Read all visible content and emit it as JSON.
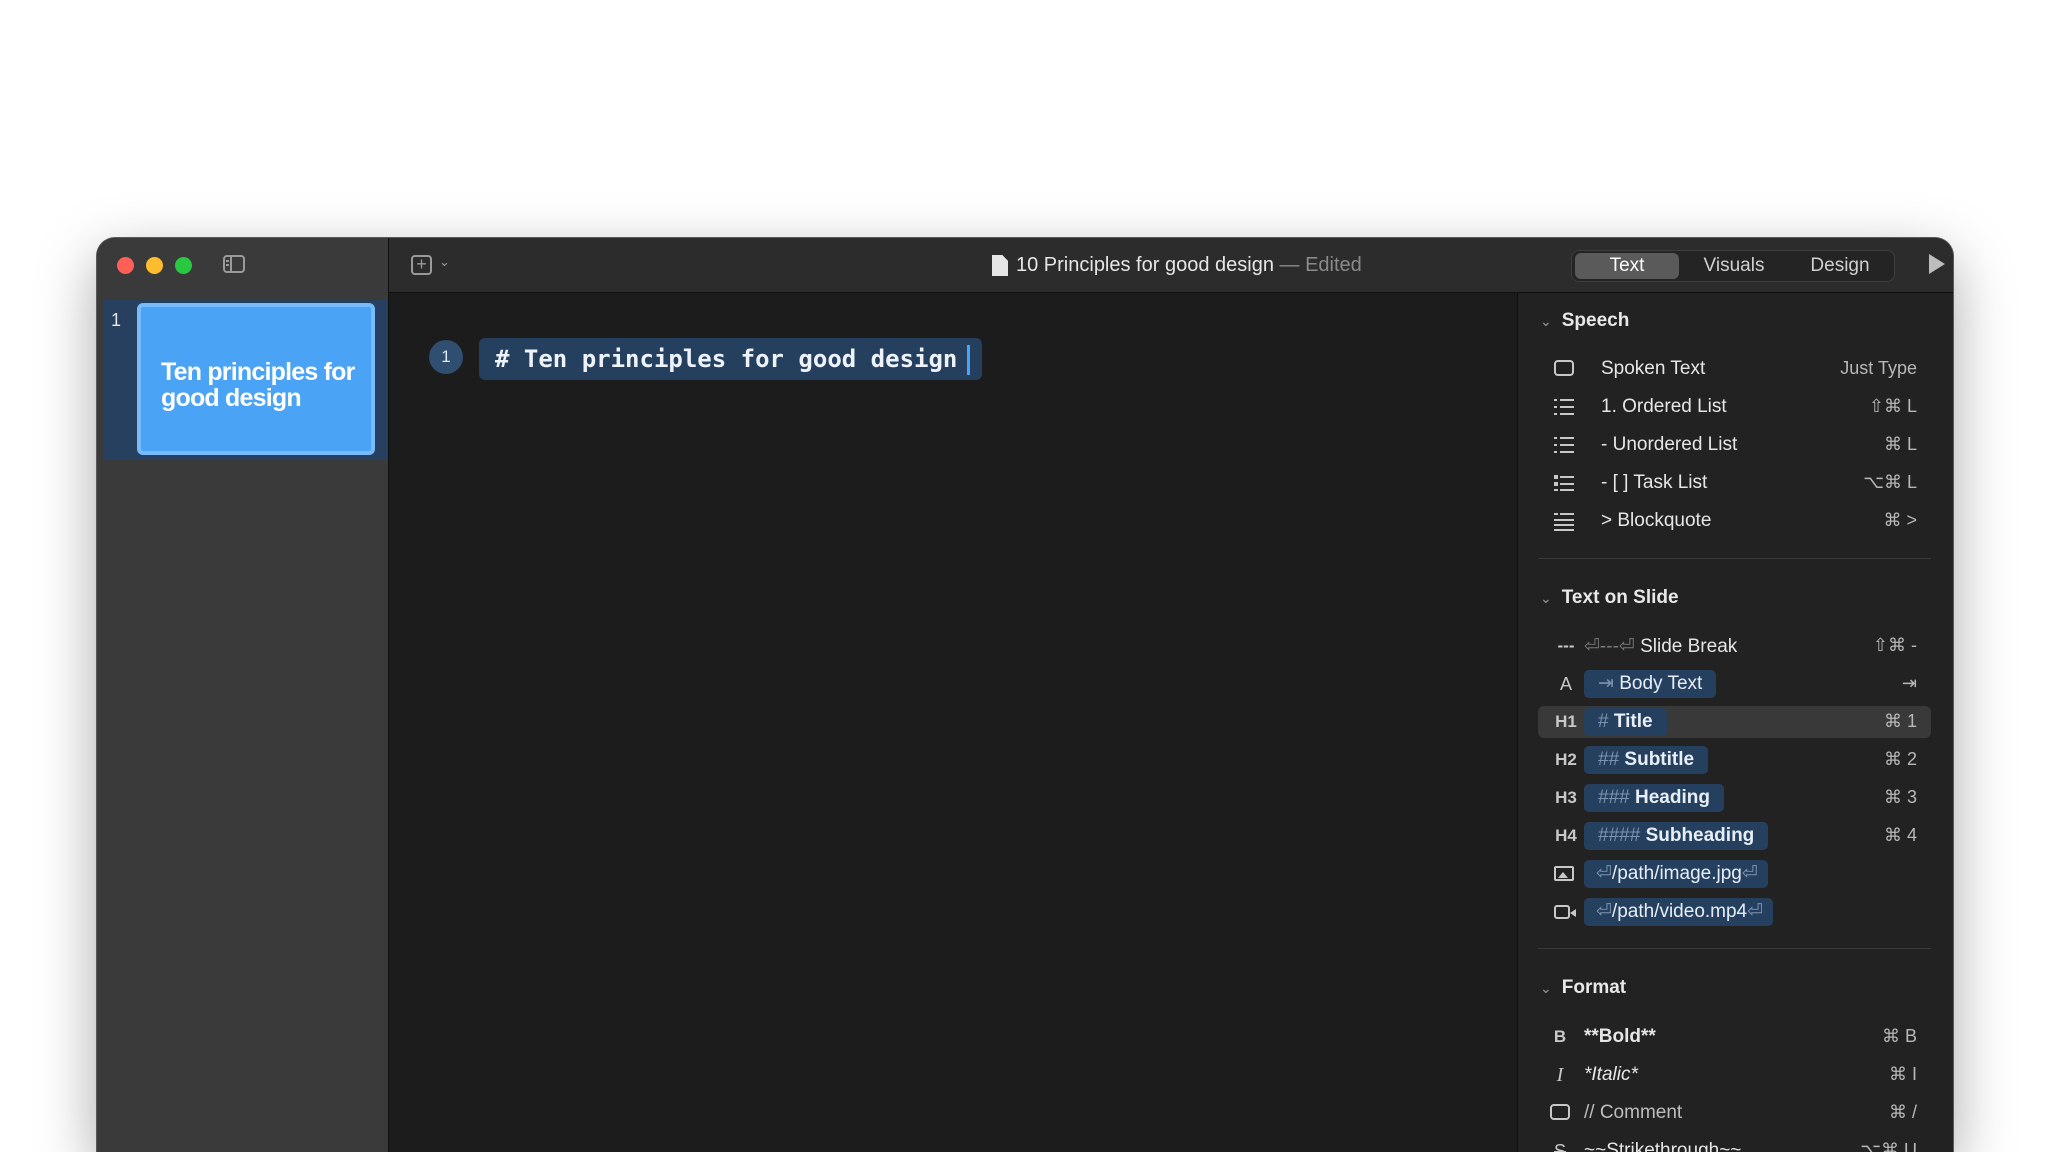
{
  "window": {
    "doc_title": "10 Principles for good design",
    "separator": "—",
    "edited": "Edited"
  },
  "toolbar": {
    "tabs": [
      {
        "label": "Text",
        "active": true
      },
      {
        "label": "Visuals",
        "active": false
      },
      {
        "label": "Design",
        "active": false
      }
    ]
  },
  "sidebar": {
    "slides": [
      {
        "number": "1",
        "title": "Ten principles for good design"
      }
    ]
  },
  "editor": {
    "lines": [
      {
        "number": "1",
        "text": "# Ten principles for good design"
      }
    ]
  },
  "panel": {
    "speech": {
      "title": "Speech",
      "items": [
        {
          "icon": "speech-bubble-icon",
          "label": "Spoken Text",
          "shortcut": "Just Type"
        },
        {
          "icon": "ordered-list-icon",
          "label": "1. Ordered List",
          "shortcut": "⇧⌘ L"
        },
        {
          "icon": "unordered-list-icon",
          "label": "- Unordered List",
          "shortcut": "⌘ L"
        },
        {
          "icon": "task-list-icon",
          "label": "- [ ] Task List",
          "shortcut": "⌥⌘ L"
        },
        {
          "icon": "blockquote-icon",
          "label": "> Blockquote",
          "shortcut": "⌘ >"
        }
      ]
    },
    "text_on_slide": {
      "title": "Text on Slide",
      "items": [
        {
          "icon_text": "---",
          "prefix": "⏎---⏎",
          "label": "Slide Break",
          "shortcut": "⇧⌘ -"
        },
        {
          "icon_text": "A",
          "prefix": "⇥",
          "label": "Body Text",
          "shortcut": "⇥"
        },
        {
          "icon_text": "H1",
          "prefix": "#",
          "label": "Title",
          "shortcut": "⌘ 1"
        },
        {
          "icon_text": "H2",
          "prefix": "##",
          "label": "Subtitle",
          "shortcut": "⌘ 2"
        },
        {
          "icon_text": "H3",
          "prefix": "###",
          "label": "Heading",
          "shortcut": "⌘ 3"
        },
        {
          "icon_text": "H4",
          "prefix": "####",
          "label": "Subheading",
          "shortcut": "⌘ 4"
        },
        {
          "prefix": "⏎",
          "label": "/path/image.jpg",
          "suffix": "⏎"
        },
        {
          "prefix": "⏎",
          "label": "/path/video.mp4",
          "suffix": "⏎"
        }
      ]
    },
    "format": {
      "title": "Format",
      "items": [
        {
          "icon_text": "B",
          "label": "**Bold**",
          "shortcut": "⌘ B"
        },
        {
          "icon_text": "I",
          "label": "*Italic*",
          "shortcut": "⌘ I"
        },
        {
          "label": "// Comment",
          "shortcut": "⌘ /"
        },
        {
          "icon_text": "S",
          "label": "~~Strikethrough~~",
          "shortcut": "⌥⌘ U"
        }
      ]
    }
  }
}
